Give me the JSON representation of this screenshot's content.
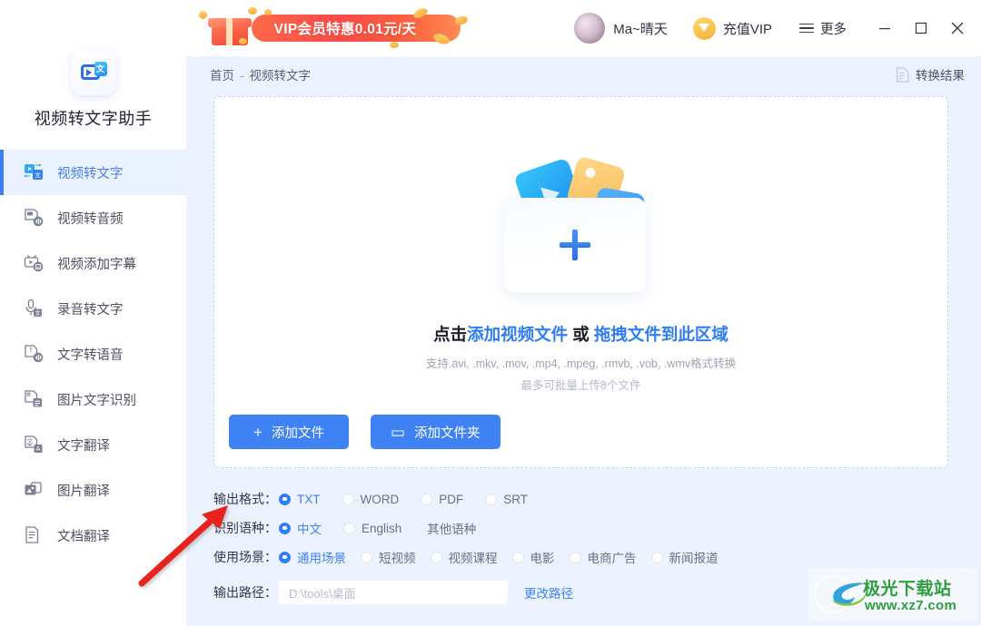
{
  "app": {
    "brand_name": "视频转文字助手",
    "logo_badge": "文"
  },
  "titlebar": {
    "vip_banner_text": "VIP会员特惠0.01元/天",
    "user_name": "Ma~晴天",
    "vip_button_label": "充值VIP",
    "more_label": "更多",
    "minimize_label": "—",
    "maximize_label": "□",
    "close_label": "✕"
  },
  "sidebar": {
    "items": [
      {
        "label": "视频转文字",
        "icon": "video-to-text-icon",
        "active": true
      },
      {
        "label": "视频转音频",
        "icon": "video-to-audio-icon",
        "active": false
      },
      {
        "label": "视频添加字幕",
        "icon": "add-subtitle-icon",
        "active": false
      },
      {
        "label": "录音转文字",
        "icon": "audio-to-text-icon",
        "active": false
      },
      {
        "label": "文字转语音",
        "icon": "text-to-speech-icon",
        "active": false
      },
      {
        "label": "图片文字识别",
        "icon": "image-ocr-icon",
        "active": false
      },
      {
        "label": "文字翻译",
        "icon": "text-translate-icon",
        "active": false
      },
      {
        "label": "图片翻译",
        "icon": "image-translate-icon",
        "active": false
      },
      {
        "label": "文档翻译",
        "icon": "document-translate-icon",
        "active": false
      }
    ]
  },
  "breadcrumb": {
    "home": "首页",
    "separator": "-",
    "current": "视频转文字"
  },
  "toolbar": {
    "result_label": "转换结果"
  },
  "dropzone": {
    "title_prefix": "点击",
    "title_link1": "添加视频文件",
    "title_mid": " 或 ",
    "title_link2": "拖拽文件到此区域",
    "formats_note": "支持.avi, .mkv, .mov, .mp4, .mpeg, .rmvb, .vob, .wmv格式转换",
    "batch_note": "最多可批量上传8个文件",
    "add_file_label": "添加文件",
    "add_folder_label": "添加文件夹",
    "add_file_glyph": "+",
    "add_folder_glyph": "▭"
  },
  "settings": {
    "output_format": {
      "label": "输出格式：",
      "options": [
        "TXT",
        "WORD",
        "PDF",
        "SRT"
      ],
      "selected": "TXT"
    },
    "language": {
      "label": "识别语种：",
      "options": [
        "中文",
        "English"
      ],
      "selected": "中文",
      "other_label": "其他语种"
    },
    "scene": {
      "label": "使用场景：",
      "options": [
        "通用场景",
        "短视频",
        "视频课程",
        "电影",
        "电商广告",
        "新闻报道"
      ],
      "selected": "通用场景"
    },
    "output_path": {
      "label": "输出路径：",
      "value": "D:\\tools\\桌面",
      "change_label": "更改路径"
    }
  },
  "watermark": {
    "title": "极光下载站",
    "url": "www.xz7.com"
  },
  "colors": {
    "accent": "#3f82f3",
    "active_nav_bg": "#eaf2ff",
    "page_bg": "#edf3fe",
    "banner_red": "#f94a4a",
    "vip_gold": "#f6b23c",
    "watermark_green": "#2f9e3f",
    "annotation_red": "#e8201c"
  }
}
